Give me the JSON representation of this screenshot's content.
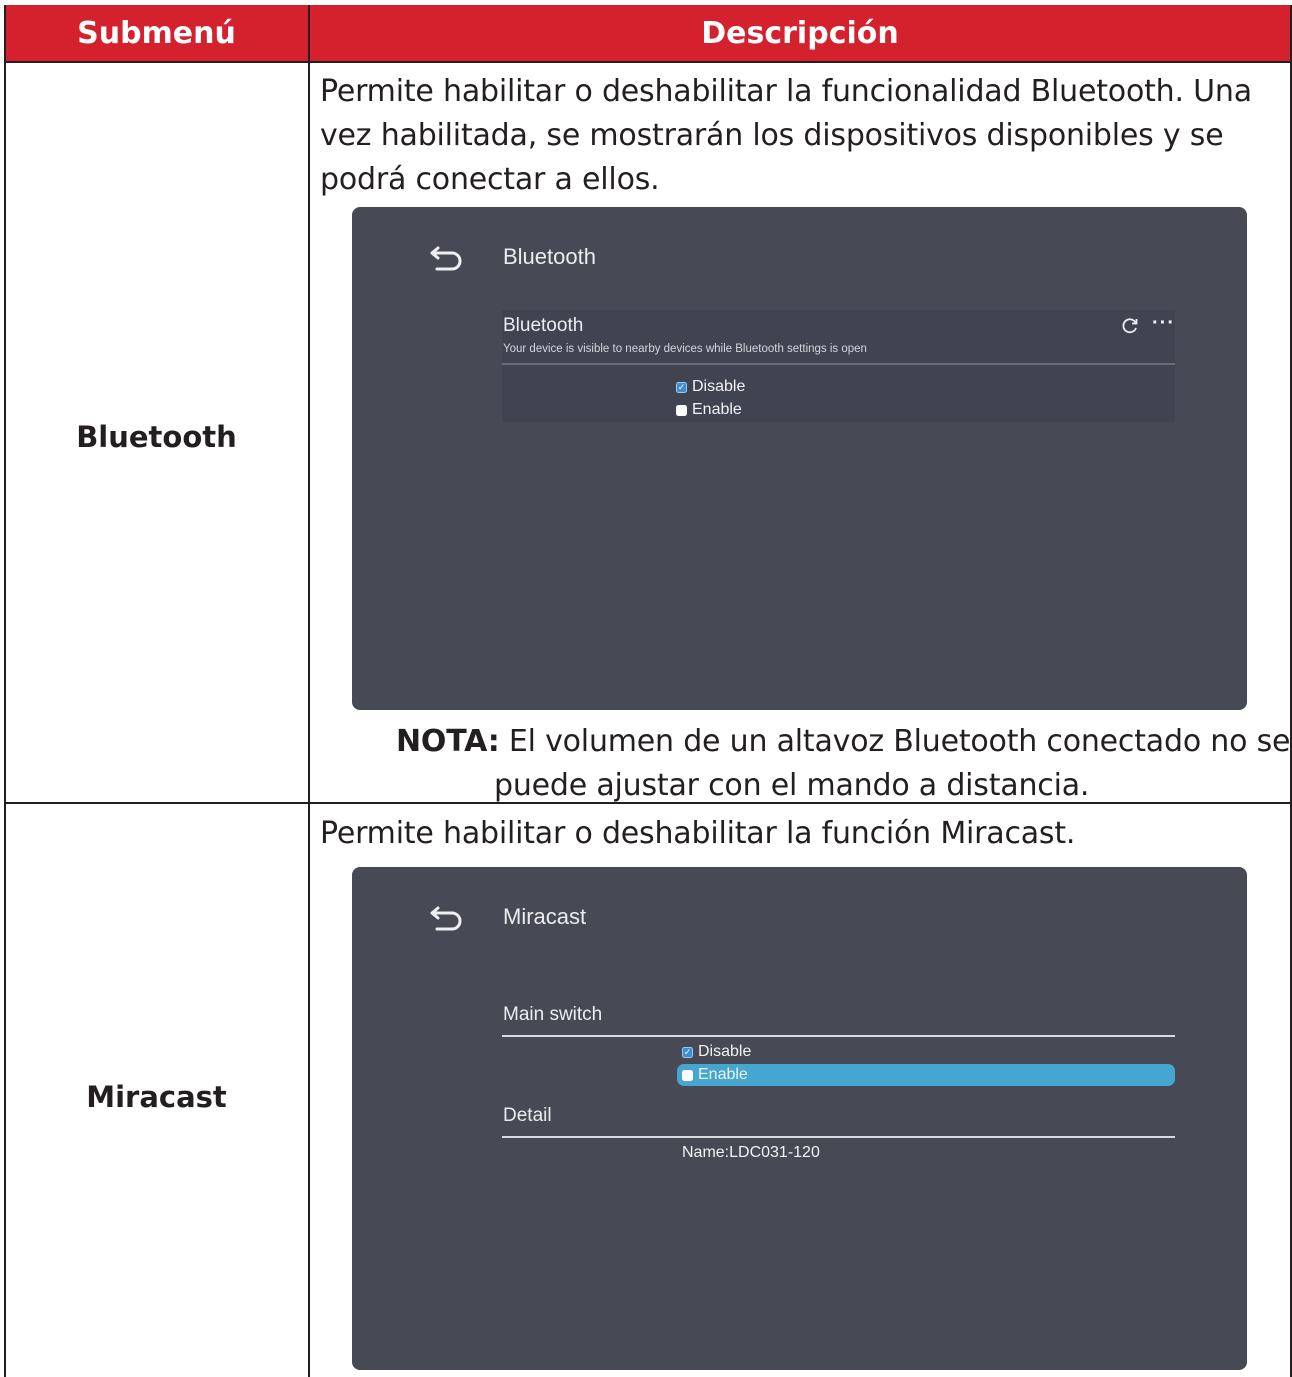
{
  "table": {
    "header": {
      "col1": "Submenú",
      "col2": "Descripción"
    },
    "rows": [
      {
        "submenu": "Bluetooth",
        "description": "Permite habilitar o deshabilitar la funcionalidad Bluetooth. Una vez habilitada, se mostrarán los dispositivos disponibles y se podrá conectar a ellos.",
        "screen": {
          "title": "Bluetooth",
          "section_title": "Bluetooth",
          "section_subtitle": "Your device is visible to nearby devices while Bluetooth settings is open",
          "options": [
            {
              "label": "Disable",
              "checked": true
            },
            {
              "label": "Enable",
              "checked": false
            }
          ],
          "icons": [
            "back-arrow-icon",
            "refresh-icon",
            "more-icon"
          ]
        },
        "note_label": "NOTA:",
        "note_text_1": "El volumen de un altavoz Bluetooth conectado no se",
        "note_text_2": "puede ajustar con el mando a distancia."
      },
      {
        "submenu": "Miracast",
        "description": "Permite habilitar o deshabilitar la función Miracast.",
        "screen": {
          "title": "Miracast",
          "main_switch_label": "Main switch",
          "options": [
            {
              "label": "Disable",
              "checked": true
            },
            {
              "label": "Enable",
              "checked": false,
              "highlighted": true
            }
          ],
          "detail_label": "Detail",
          "device_name": "Name:LDC031-120",
          "icons": [
            "back-arrow-icon"
          ]
        }
      }
    ]
  },
  "colors": {
    "header_bg": "#d5202e",
    "screen_bg": "#474a55",
    "highlight": "#45a7cf",
    "checkbox_on": "#3f8ed4"
  }
}
